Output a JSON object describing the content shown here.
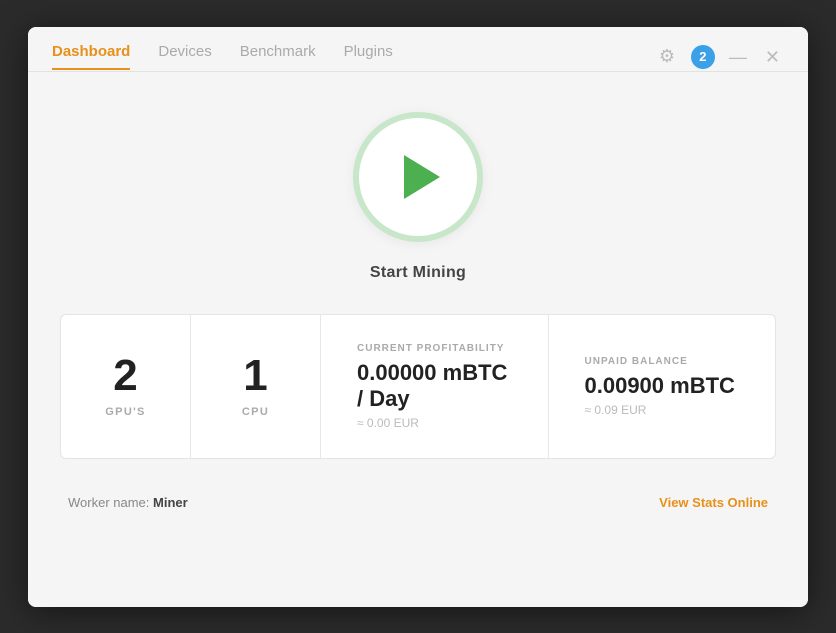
{
  "nav": {
    "tabs": [
      {
        "label": "Dashboard",
        "active": true
      },
      {
        "label": "Devices",
        "active": false
      },
      {
        "label": "Benchmark",
        "active": false
      },
      {
        "label": "Plugins",
        "active": false
      }
    ]
  },
  "titlebar": {
    "notification_count": "2",
    "gear_icon": "⚙",
    "minimize_icon": "—",
    "close_icon": "✕"
  },
  "main": {
    "start_mining_label": "Start Mining"
  },
  "stats": {
    "gpus": {
      "number": "2",
      "label": "GPU'S"
    },
    "cpu": {
      "number": "1",
      "label": "CPU"
    },
    "profitability": {
      "title": "CURRENT PROFITABILITY",
      "main_value": "0.00000 mBTC / Day",
      "sub_value": "≈ 0.00 EUR"
    },
    "balance": {
      "title": "UNPAID BALANCE",
      "main_value": "0.00900 mBTC",
      "sub_value": "≈ 0.09 EUR"
    }
  },
  "footer": {
    "worker_prefix": "Worker name: ",
    "worker_name": "Miner",
    "view_stats_label": "View Stats Online"
  }
}
